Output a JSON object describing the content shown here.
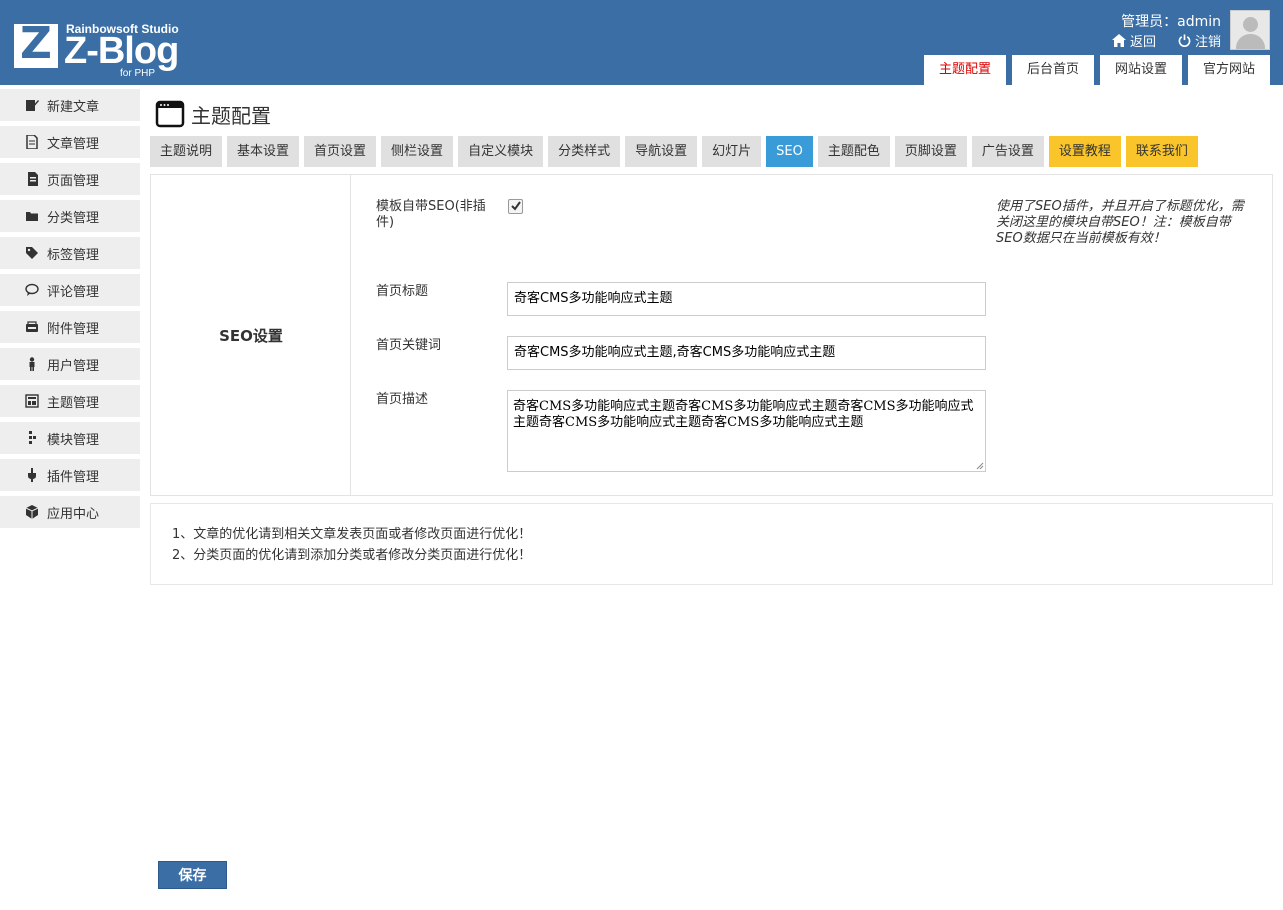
{
  "brand": {
    "studio": "Rainbowsoft Studio",
    "name": "Z-Blog",
    "sub": "for PHP",
    "mark": "Z"
  },
  "header": {
    "admin_label": "管理员：admin",
    "back_label": "返回",
    "logout_label": "注销",
    "tabs": [
      "主题配置",
      "后台首页",
      "网站设置",
      "官方网站"
    ]
  },
  "sidebar": {
    "items": [
      "新建文章",
      "文章管理",
      "页面管理",
      "分类管理",
      "标签管理",
      "评论管理",
      "附件管理",
      "用户管理",
      "主题管理",
      "模块管理",
      "插件管理",
      "应用中心"
    ]
  },
  "page": {
    "title": "主题配置"
  },
  "tabs": [
    "主题说明",
    "基本设置",
    "首页设置",
    "侧栏设置",
    "自定义模块",
    "分类样式",
    "导航设置",
    "幻灯片",
    "SEO",
    "主题配色",
    "页脚设置",
    "广告设置",
    "设置教程",
    "联系我们"
  ],
  "seo": {
    "section_title": "SEO设置",
    "builtin_label": "模板自带SEO(非插件)",
    "builtin_checked": true,
    "note": "使用了SEO插件，并且开启了标题优化，需关闭这里的模块自带SEO！注：模板自带SEO数据只在当前模板有效！",
    "home_title_label": "首页标题",
    "home_title_value": "奇客CMS多功能响应式主题",
    "home_keywords_label": "首页关键词",
    "home_keywords_value": "奇客CMS多功能响应式主题,奇客CMS多功能响应式主题",
    "home_desc_label": "首页描述",
    "home_desc_value": "奇客CMS多功能响应式主题奇客CMS多功能响应式主题奇客CMS多功能响应式主题奇客CMS多功能响应式主题奇客CMS多功能响应式主题"
  },
  "tips": [
    "1、文章的优化请到相关文章发表页面或者修改页面进行优化！",
    "2、分类页面的优化请到添加分类或者修改分类页面进行优化！"
  ],
  "save_label": "保存"
}
